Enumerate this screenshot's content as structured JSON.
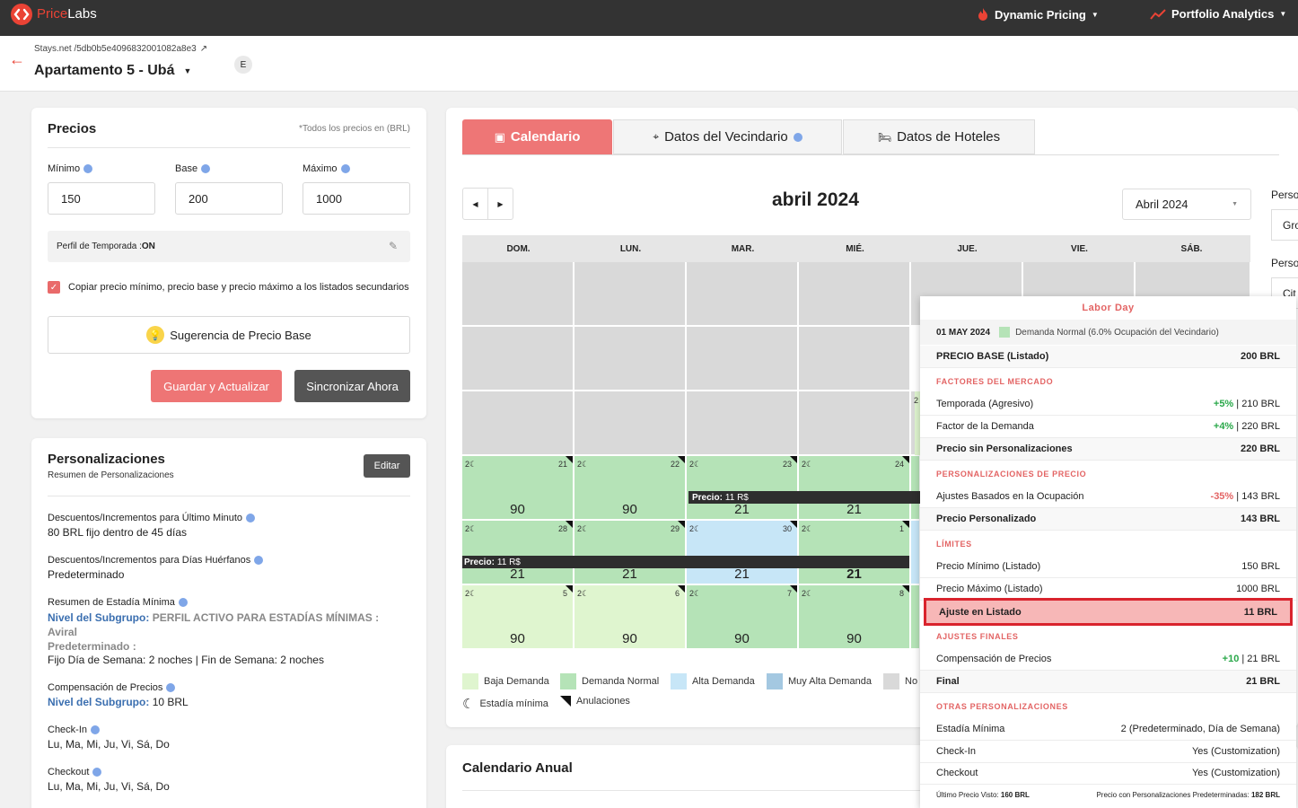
{
  "topbar": {
    "brand_a": "Price",
    "brand_b": "Labs",
    "nav_dynamic": "Dynamic Pricing",
    "nav_portfolio": "Portfolio Analytics"
  },
  "listing": {
    "breadcrumb": "Stays.net /5db0b5e4096832001082a8e3",
    "name": "Apartamento 5 - Ubá",
    "badge": "E"
  },
  "precios": {
    "title": "Precios",
    "currency_note": "*Todos los precios en (BRL)",
    "min_label": "Mínimo",
    "min_value": "150",
    "base_label": "Base",
    "base_value": "200",
    "max_label": "Máximo",
    "max_value": "1000",
    "season_label": "Perfil de Temporada : ",
    "season_value": "ON",
    "copy_label": "Copiar precio mínimo, precio base y precio máximo a los listados secundarios",
    "suggest_label": "Sugerencia de Precio Base",
    "save_label": "Guardar y Actualizar",
    "sync_label": "Sincronizar Ahora"
  },
  "personalizaciones": {
    "title": "Personalizaciones",
    "subtitle": "Resumen de Personalizaciones",
    "edit_label": "Editar",
    "lastminute_title": "Descuentos/Incrementos para Último Minuto",
    "lastminute_value": "80 BRL fijo dentro de 45 días",
    "orphan_title": "Descuentos/Incrementos para Días Huérfanos",
    "orphan_value": "Predeterminado",
    "minstay_title": "Resumen de Estadía Mínima",
    "minstay_sub_label": "Nivel del Subgrupo:",
    "minstay_sub_value": "PERFIL ACTIVO PARA ESTADÍAS MÍNIMAS :",
    "minstay_sub_value2": "Aviral",
    "minstay_default_label": "Predeterminado :",
    "minstay_default_value": "Fijo Día de Semana: 2 noches | Fin de Semana: 2 noches",
    "comp_title": "Compensación de Precios",
    "comp_sub_label": "Nivel del Subgrupo:",
    "comp_value": "10 BRL",
    "checkin_title": "Check-In",
    "checkin_value": "Lu, Ma, Mi, Ju, Vi, Sá, Do",
    "checkout_title": "Checkout",
    "checkout_value": "Lu, Ma, Mi, Ju, Vi, Sá, Do"
  },
  "tabs": {
    "calendar": "Calendario",
    "neighborhood": "Datos del Vecindario",
    "hotels": "Datos de Hoteles"
  },
  "calendar": {
    "month_title": "abril 2024",
    "month_select": "Abril 2024",
    "weekdays": [
      "DOM.",
      "LUN.",
      "MAR.",
      "MIÉ.",
      "JUE.",
      "VIE.",
      "SÁB."
    ],
    "side_label_1": "Perso",
    "side_input_1": "Gro",
    "side_label_2": "Perso",
    "side_input_2": "Cit",
    "row4": [
      {
        "min": "2",
        "day": "21",
        "price": "90"
      },
      {
        "min": "2",
        "day": "22",
        "price": "90"
      },
      {
        "min": "2",
        "day": "23",
        "price": "21"
      },
      {
        "min": "2",
        "day": "24",
        "price": "21"
      }
    ],
    "row5": [
      {
        "min": "2",
        "day": "28",
        "price": "21"
      },
      {
        "min": "2",
        "day": "29",
        "price": "21"
      },
      {
        "min": "2",
        "day": "30",
        "price": "21"
      },
      {
        "min": "2",
        "day": "1",
        "price": "21"
      }
    ],
    "row6": [
      {
        "min": "2",
        "day": "5",
        "price": "90"
      },
      {
        "min": "2",
        "day": "6",
        "price": "90"
      },
      {
        "min": "2",
        "day": "7",
        "price": "90"
      },
      {
        "min": "2",
        "day": "8",
        "price": "90"
      }
    ],
    "jue_min": "2",
    "tooltip_label": "Precio:",
    "tooltip_value": "11 R$",
    "legend": {
      "low": "Baja Demanda",
      "normal": "Demanda Normal",
      "high": "Alta Demanda",
      "veryhigh": "Muy Alta Demanda",
      "no": "No",
      "minstay": "Estadía mínima",
      "cancel": "Anulaciones"
    },
    "colors": {
      "low": "#dff5cf",
      "normal": "#b5e3b7",
      "high": "#c7e6f7",
      "veryhigh": "#a4c8e1",
      "gray": "#d9d9d9",
      "accent": "#ea6b6b"
    }
  },
  "annual": {
    "title": "Calendario Anual"
  },
  "popup": {
    "holiday": "Labor Day",
    "date": "01 MAY 2024",
    "demand": "Demanda Normal (6.0% Ocupación del Vecindario)",
    "base_label": "PRECIO BASE (Listado)",
    "base_value": "200 BRL",
    "sec_market": "FACTORES DEL MERCADO",
    "seasonal_label": "Temporada (Agresivo)",
    "seasonal_pct": "+5%",
    "seasonal_value": " | 210 BRL",
    "demand_label": "Factor de la Demanda",
    "demand_pct": "+4%",
    "demand_value": " | 220 BRL",
    "nocust_label": "Precio sin Personalizaciones",
    "nocust_value": "220 BRL",
    "sec_custom": "PERSONALIZACIONES DE PRECIO",
    "occ_label": "Ajustes Basados en la Ocupación",
    "occ_pct": "-35%",
    "occ_value": " | 143 BRL",
    "custom_label": "Precio Personalizado",
    "custom_value": "143 BRL",
    "sec_limits": "LÍMITES",
    "minp_label": "Precio Mínimo (Listado)",
    "minp_value": "150 BRL",
    "maxp_label": "Precio Máximo (Listado)",
    "maxp_value": "1000 BRL",
    "adj_label": "Ajuste en Listado",
    "adj_value": "11 BRL",
    "sec_final": "AJUSTES FINALES",
    "comp_label": "Compensación de Precios",
    "comp_pct": "+10",
    "comp_value": " | 21 BRL",
    "final_label": "Final",
    "final_value": "21 BRL",
    "sec_other": "OTRAS PERSONALIZACIONES",
    "minstay_label": "Estadía Mínima",
    "minstay_value": "2 (Predeterminado, Día de Semana)",
    "checkin_label": "Check-In",
    "checkin_value": "Yes (Customization)",
    "checkout_label": "Checkout",
    "checkout_value": "Yes (Customization)",
    "last_seen_label": "Último Precio Visto: ",
    "last_seen_value": "160 BRL",
    "default_label": "Precio con Personalizaciones Predeterminadas: ",
    "default_value": "182 BRL"
  }
}
